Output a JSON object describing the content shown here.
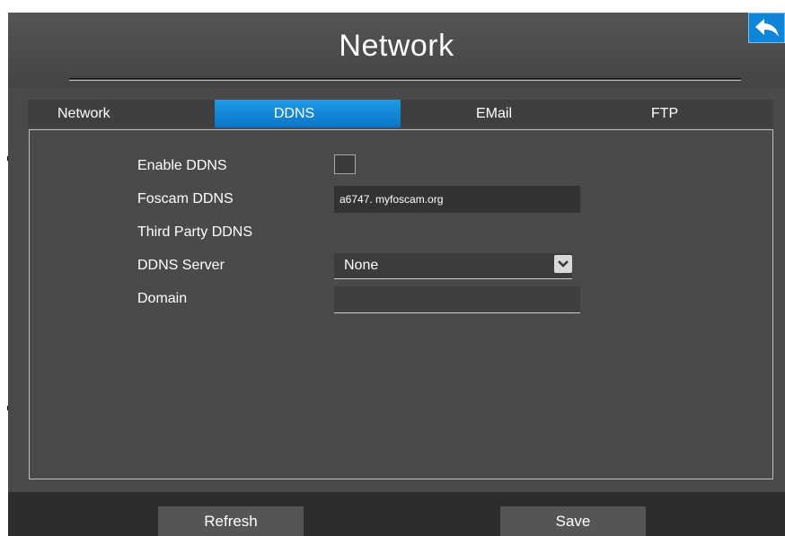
{
  "header": {
    "title": "Network"
  },
  "tabs": [
    {
      "label": "Network",
      "active": false
    },
    {
      "label": "DDNS",
      "active": true
    },
    {
      "label": "EMail",
      "active": false
    },
    {
      "label": "FTP",
      "active": false
    }
  ],
  "form": {
    "enable_ddns_label": "Enable DDNS",
    "enable_ddns_checked": false,
    "foscam_ddns_label": "Foscam DDNS",
    "foscam_ddns_value": "a6747. myfoscam.org",
    "third_party_label": "Third Party DDNS",
    "ddns_server_label": "DDNS Server",
    "ddns_server_value": "None",
    "domain_label": "Domain",
    "domain_value": ""
  },
  "footer": {
    "refresh_label": "Refresh",
    "save_label": "Save"
  },
  "icons": {
    "back": "back-arrow-icon",
    "dropdown": "chevron-down-icon"
  },
  "colors": {
    "accent": "#0a74c6",
    "background": "#4a4a4a"
  }
}
